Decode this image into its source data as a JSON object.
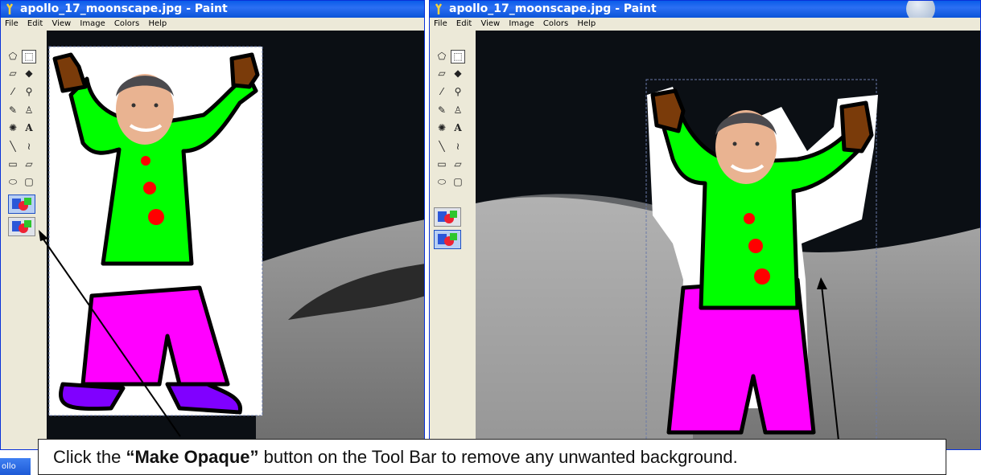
{
  "left_window": {
    "title": "apollo_17_moonscape.jpg - Paint",
    "menu": [
      "File",
      "Edit",
      "View",
      "Image",
      "Colors",
      "Help"
    ]
  },
  "right_window": {
    "title": "apollo_17_moonscape.jpg - Paint",
    "menu": [
      "File",
      "Edit",
      "View",
      "Image",
      "Colors",
      "Help"
    ]
  },
  "tools": [
    "free-form-select",
    "select",
    "eraser",
    "fill",
    "color-picker",
    "magnifier",
    "pencil",
    "brush",
    "airbrush",
    "text",
    "line",
    "curve",
    "rectangle",
    "polygon",
    "ellipse",
    "rounded-rectangle"
  ],
  "taskbar": {
    "label": "ollo"
  },
  "callout": {
    "text_before": "Click the ",
    "text_bold": "“Make Opaque”",
    "text_after": " button on the Tool Bar to remove any unwanted background."
  },
  "colors": {
    "shirt": "#00ff00",
    "pants": "#ff00ff",
    "shoes": "#8000ff",
    "buttons": "#ff0000",
    "hands": "#7a3b0a",
    "titlebar": "#0a5ce9",
    "sky": "#0b0f14"
  }
}
